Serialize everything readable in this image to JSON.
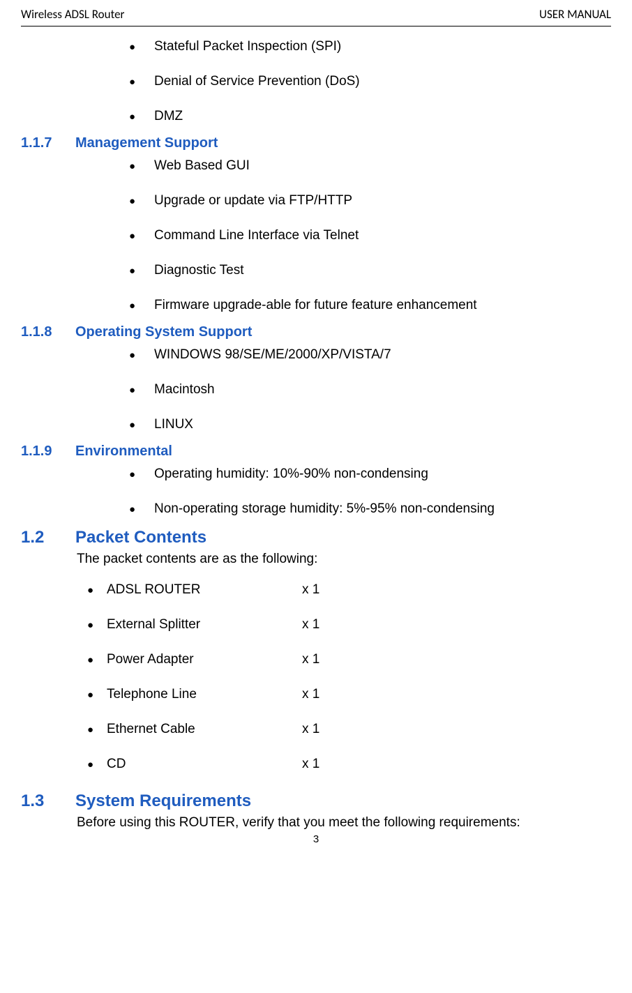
{
  "header": {
    "left": "Wireless ADSL Router",
    "right": "USER MANUAL"
  },
  "firewall_items": [
    "Stateful Packet Inspection (SPI)",
    "Denial of Service Prevention (DoS)",
    "DMZ"
  ],
  "s117": {
    "num": "1.1.7",
    "title": "Management Support",
    "items": [
      "Web Based GUI",
      "Upgrade or update via FTP/HTTP",
      "Command Line Interface via Telnet",
      "Diagnostic Test",
      "Firmware upgrade-able for future feature enhancement"
    ]
  },
  "s118": {
    "num": "1.1.8",
    "title": "Operating System Support",
    "items": [
      "WINDOWS 98/SE/ME/2000/XP/VISTA/7",
      "Macintosh",
      "LINUX"
    ]
  },
  "s119": {
    "num": "1.1.9",
    "title": "Environmental",
    "items": [
      "Operating humidity: 10%-90% non-condensing",
      "Non-operating storage humidity: 5%-95% non-condensing"
    ]
  },
  "s12": {
    "num": "1.2",
    "title": "Packet Contents",
    "intro": "The packet contents are as the following:",
    "items": [
      {
        "name": "ADSL ROUTER",
        "qty": "x 1"
      },
      {
        "name": "External Splitter",
        "qty": "x 1"
      },
      {
        "name": "Power Adapter",
        "qty": "x 1"
      },
      {
        "name": "Telephone Line",
        "qty": "x 1"
      },
      {
        "name": "Ethernet Cable",
        "qty": "x 1"
      },
      {
        "name": "CD",
        "qty": " x 1"
      }
    ]
  },
  "s13": {
    "num": "1.3",
    "title": "System Requirements",
    "intro": "Before using this ROUTER, verify that you meet the following requirements:"
  },
  "pagenum": "3"
}
